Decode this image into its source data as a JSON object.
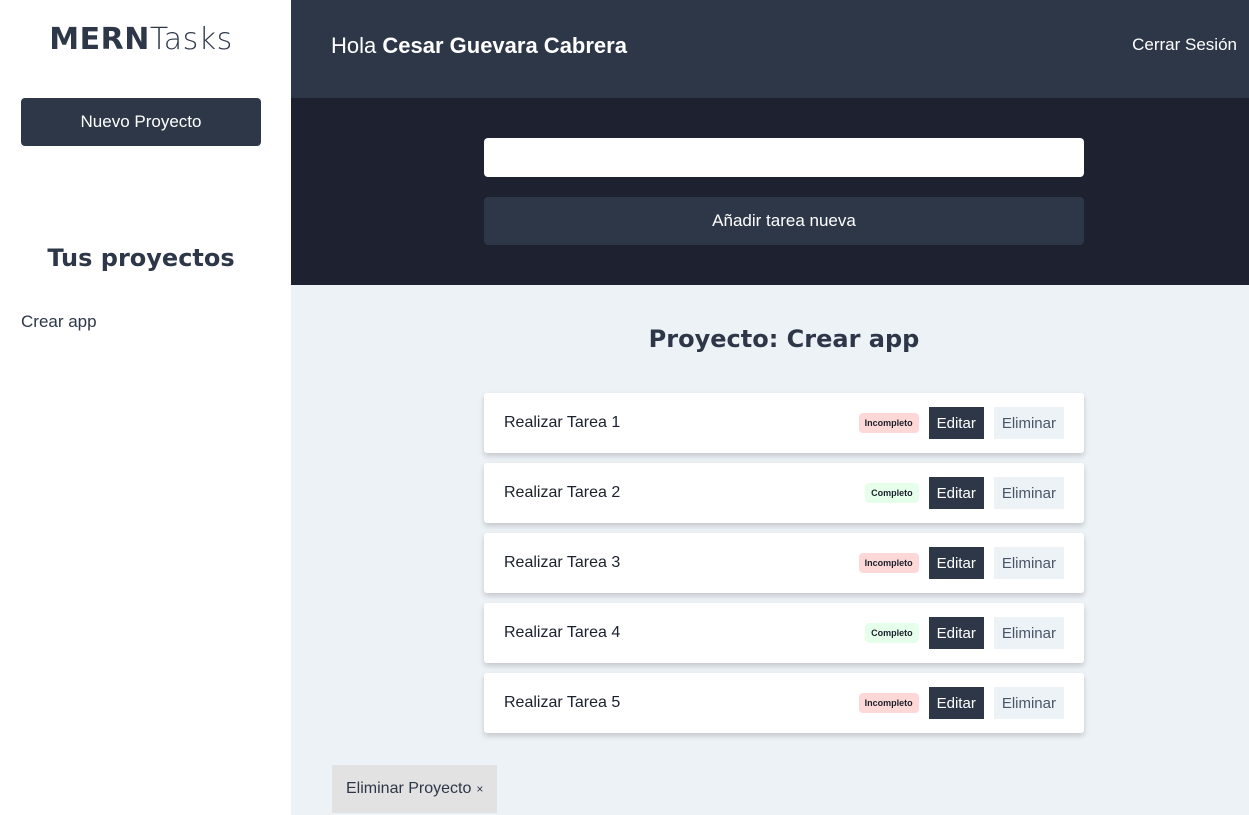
{
  "sidebar": {
    "logo_bold": "MERN",
    "logo_light": "Tasks",
    "new_project_label": "Nuevo Proyecto",
    "projects_heading": "Tus proyectos",
    "projects": [
      {
        "label": "Crear app"
      }
    ]
  },
  "header": {
    "greeting": "Hola",
    "user_name": "Cesar Guevara Cabrera",
    "logout_label": "Cerrar Sesión"
  },
  "task_form": {
    "input_value": "",
    "input_placeholder": "",
    "submit_label": "Añadir tarea nueva"
  },
  "main": {
    "project_title": "Proyecto: Crear app",
    "edit_label": "Editar",
    "delete_label": "Eliminar",
    "tasks": [
      {
        "name": "Realizar Tarea 1",
        "status": "Incompleto"
      },
      {
        "name": "Realizar Tarea 2",
        "status": "Completo"
      },
      {
        "name": "Realizar Tarea 3",
        "status": "Incompleto"
      },
      {
        "name": "Realizar Tarea 4",
        "status": "Completo"
      },
      {
        "name": "Realizar Tarea 5",
        "status": "Incompleto"
      }
    ],
    "delete_project_label": "Eliminar Proyecto",
    "delete_project_icon": "×"
  },
  "colors": {
    "dark": "#2d3748",
    "darker": "#1e2230",
    "background": "#edf2f7",
    "incomplete_badge": "#fed7d7",
    "complete_badge": "#e6ffea"
  }
}
